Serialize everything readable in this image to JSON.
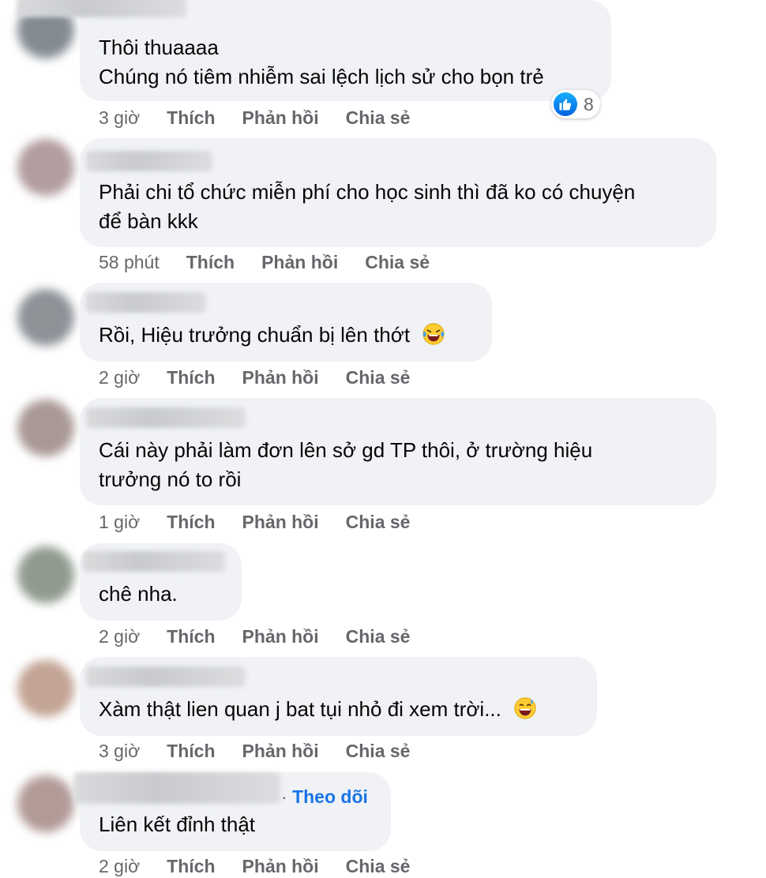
{
  "comments": [
    {
      "lines": [
        "Thôi thuaaaa",
        "Chúng nó tiêm nhiễm sai lệch lịch sử cho bọn trẻ"
      ],
      "time": "3 giờ",
      "reaction_count": "8"
    },
    {
      "lines": [
        "Phải chi tổ chức miễn phí cho học sinh thì đã ko có chuyện",
        "để bàn kkk"
      ],
      "time": "58 phút"
    },
    {
      "lines": [
        "Rồi, Hiệu trưởng chuẩn bị lên thớt"
      ],
      "time": "2 giờ",
      "emoji": "laughing-tears"
    },
    {
      "lines": [
        "Cái này phải làm đơn lên sở gd TP thôi, ở trường hiệu",
        "trưởng nó to rồi"
      ],
      "time": "1 giờ"
    },
    {
      "lines": [
        "chê nha."
      ],
      "time": "2 giờ"
    },
    {
      "lines": [
        "Xàm thật lien quan j bat tụi nhỏ đi xem trời..."
      ],
      "time": "3 giờ",
      "emoji": "grinning-sweat"
    },
    {
      "lines": [
        "Liên kết đỉnh thật"
      ],
      "time": "2 giờ",
      "follow": "Theo dõi"
    }
  ],
  "actions": {
    "like": "Thích",
    "reply": "Phản hồi",
    "share": "Chia sẻ"
  },
  "colors": {
    "bubble": "#f0f2f5",
    "meta": "#65676b",
    "link": "#1a73e8",
    "like": "#0062df"
  }
}
